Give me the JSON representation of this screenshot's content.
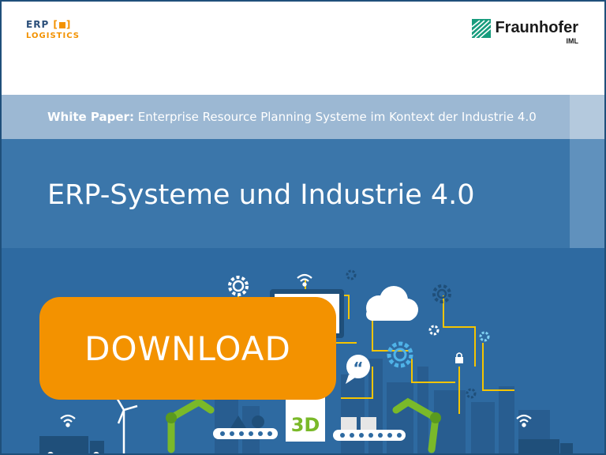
{
  "header": {
    "erp_logo_top": "ERP",
    "erp_logo_bottom": "LOGISTICS",
    "fraunhofer_name": "Fraunhofer",
    "fraunhofer_sub": "IML"
  },
  "subtitle": {
    "prefix": "White Paper:",
    "text": "Enterprise Resource Planning Systeme im Kontext der Industrie 4.0"
  },
  "title": "ERP-Systeme und Industrie 4.0",
  "download_label": "DOWNLOAD",
  "illustration": {
    "printer_label": "3D",
    "icons": [
      "gear-icon",
      "wifi-icon",
      "cloud-icon",
      "speech-bubble-icon",
      "lock-icon",
      "robot-arm-icon",
      "wind-turbine-icon",
      "truck-icon",
      "conveyor-icon",
      "factory-icon"
    ]
  },
  "colors": {
    "brand_blue": "#3b76aa",
    "light_blue": "#9cb8d3",
    "illustration_bg": "#2e6aa1",
    "accent_orange": "#f39200",
    "robot_green": "#7ab929"
  }
}
